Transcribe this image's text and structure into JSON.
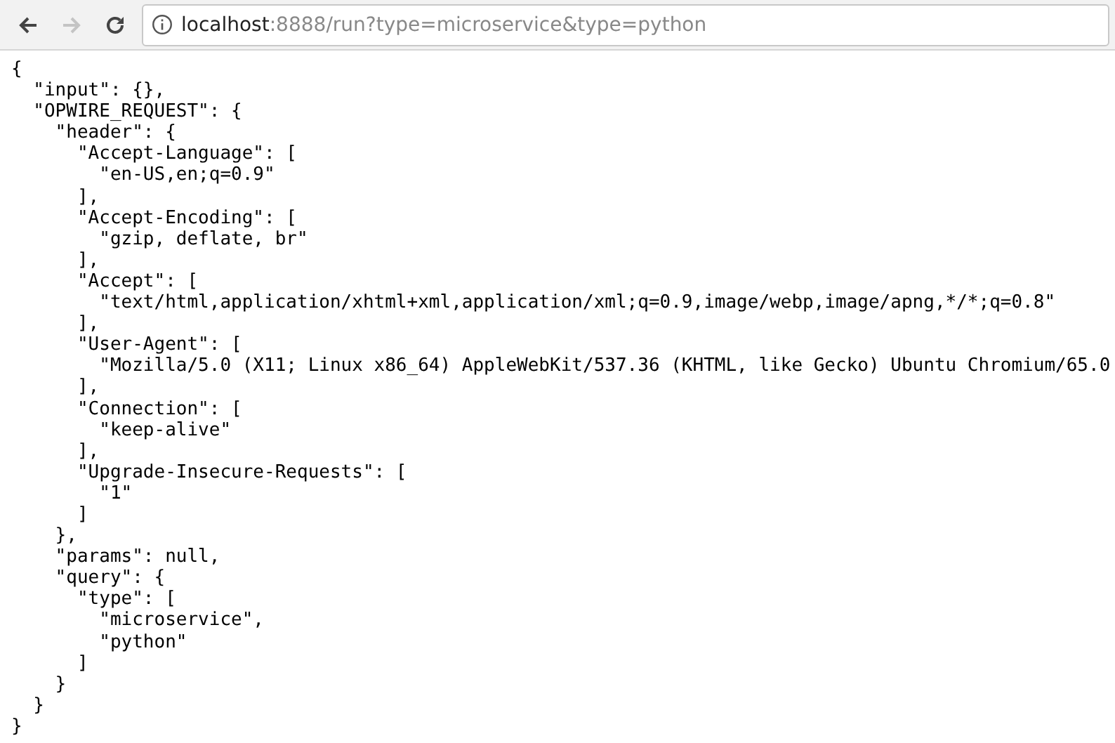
{
  "toolbar": {
    "back": {
      "disabled": false
    },
    "forward": {
      "disabled": true
    },
    "address": {
      "host": "localhost",
      "rest": ":8888/run?type=microservice&type=python"
    }
  },
  "content": {
    "lines": [
      "{",
      "  \"input\": {},",
      "  \"OPWIRE_REQUEST\": {",
      "    \"header\": {",
      "      \"Accept-Language\": [",
      "        \"en-US,en;q=0.9\"",
      "      ],",
      "      \"Accept-Encoding\": [",
      "        \"gzip, deflate, br\"",
      "      ],",
      "      \"Accept\": [",
      "        \"text/html,application/xhtml+xml,application/xml;q=0.9,image/webp,image/apng,*/*;q=0.8\"",
      "      ],",
      "      \"User-Agent\": [",
      "        \"Mozilla/5.0 (X11; Linux x86_64) AppleWebKit/537.36 (KHTML, like Gecko) Ubuntu Chromium/65.0",
      "      ],",
      "      \"Connection\": [",
      "        \"keep-alive\"",
      "      ],",
      "      \"Upgrade-Insecure-Requests\": [",
      "        \"1\"",
      "      ]",
      "    },",
      "    \"params\": null,",
      "    \"query\": {",
      "      \"type\": [",
      "        \"microservice\",",
      "        \"python\"",
      "      ]",
      "    }",
      "  }",
      "}"
    ]
  }
}
